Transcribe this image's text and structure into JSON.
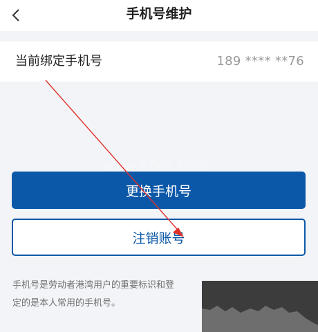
{
  "header": {
    "back_icon": "chevron-left-icon",
    "title": "手机号维护"
  },
  "binding": {
    "label": "当前绑定手机号",
    "value": "189 **** **76"
  },
  "watermark": "www.86ps.com",
  "buttons": {
    "change_label": "更换手机号",
    "cancel_label": "注销账号"
  },
  "note": {
    "line1": "手机号是劳动者港湾用户的重要标识和登",
    "line2": "定的是本人常用的手机号。"
  },
  "colors": {
    "primary": "#0b58a8",
    "annotation_arrow": "#e0302a"
  }
}
